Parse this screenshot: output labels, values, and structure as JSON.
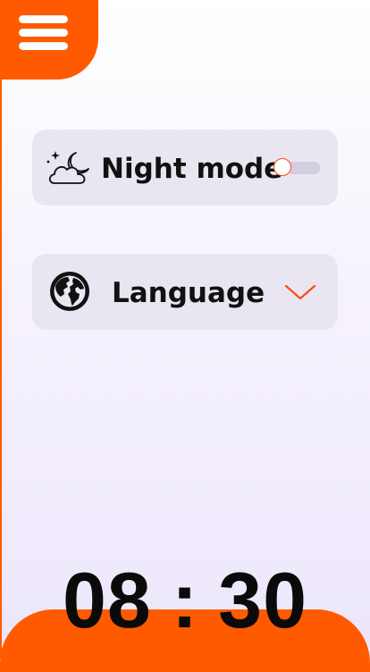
{
  "menu": {
    "icon": "hamburger-menu-icon"
  },
  "settings": {
    "night_mode": {
      "label": "Night mode",
      "icon": "cloud-moon-icon",
      "enabled": false
    },
    "language": {
      "label": "Language",
      "icon": "globe-icon",
      "dropdown_icon": "chevron-down-icon"
    }
  },
  "clock": {
    "hours": "08",
    "separator": ":",
    "minutes": "30"
  },
  "colors": {
    "accent": "#ff5a00",
    "card_background": "#e9e5f1",
    "text": "#111111",
    "toggle_track": "#d2cde0"
  }
}
